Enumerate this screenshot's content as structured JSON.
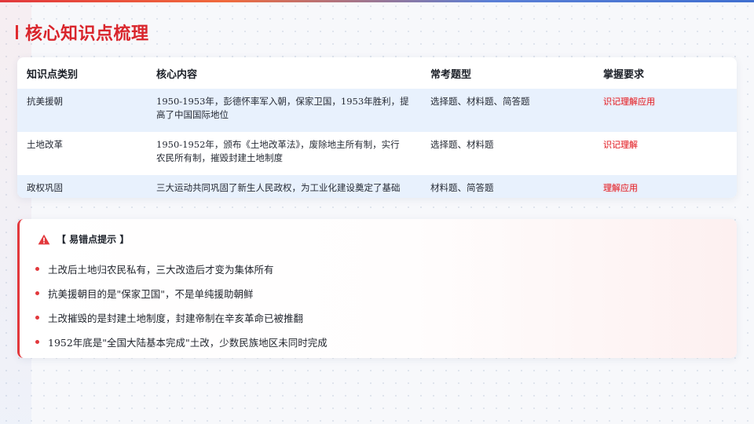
{
  "page": {
    "title": "核心知识点梳理"
  },
  "colors": {
    "accent": "#e02b2f",
    "row_highlight": "#e8f1fd",
    "requirement_text": "#e0252c"
  },
  "table": {
    "headers": [
      "知识点类别",
      "核心内容",
      "常考题型",
      "掌握要求"
    ],
    "rows": [
      {
        "category": "抗美援朝",
        "content_line1": "1950-1953年，彭德怀率军入朝，保家卫国，1953年胜利，提",
        "content_line2": "高了中国国际地位",
        "types": "选择题、材料题、简答题",
        "requirement": "识记理解应用"
      },
      {
        "category": "土地改革",
        "content_line1": "1950-1952年，颁布《土地改革法》，废除地主所有制，实行",
        "content_line2": "农民所有制，摧毁封建土地制度",
        "types": "选择题、材料题",
        "requirement": "识记理解"
      },
      {
        "category": "政权巩固",
        "content_line1": "三大运动共同巩固了新生人民政权，为工业化建设奠定了基础",
        "content_line2": "",
        "types": "材料题、简答题",
        "requirement": "理解应用"
      }
    ]
  },
  "tips": {
    "icon": "warning-triangle-icon",
    "title": "【 易错点提示 】",
    "items": [
      "土改后土地归农民私有，三大改造后才变为集体所有",
      "抗美援朝目的是\"保家卫国\"，不是单纯援助朝鲜",
      "土改摧毁的是封建土地制度，封建帝制在辛亥革命已被推翻",
      "1952年底是\"全国大陆基本完成\"土改，少数民族地区未同时完成"
    ]
  }
}
